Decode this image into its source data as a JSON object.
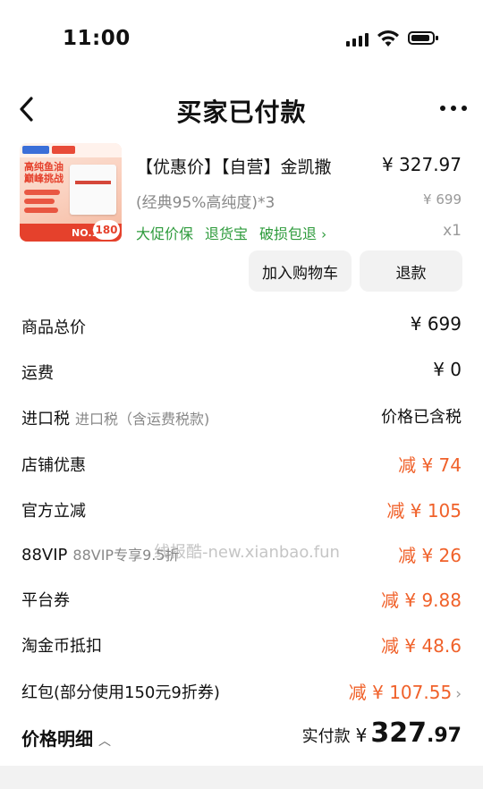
{
  "status_bar": {
    "time": "11:00"
  },
  "nav": {
    "title": "买家已付款"
  },
  "product": {
    "image": {
      "badge_number": "180",
      "rank_text": "NO.1",
      "headline_line1": "高纯鱼油",
      "headline_line2": "巅峰挑战"
    },
    "title": "【优惠价】【自营】金凯撒",
    "price": "¥ 327.97",
    "spec": "(经典95%高纯度)*3",
    "original_price": "¥ 699",
    "tags": [
      "大促价保",
      "退货宝",
      "破损包退"
    ],
    "qty": "x1",
    "add_to_cart_label": "加入购物车",
    "refund_label": "退款"
  },
  "rows": [
    {
      "label": "商品总价",
      "sub": "",
      "value": "¥ 699"
    },
    {
      "label": "运费",
      "sub": "",
      "value": "¥ 0"
    },
    {
      "label": "进口税",
      "sub": "进口税（含运费税款)",
      "value": "价格已含税"
    },
    {
      "label": "店铺优惠",
      "sub": "",
      "value": "减 ¥ 74"
    },
    {
      "label": "官方立减",
      "sub": "",
      "value": "减 ¥ 105"
    },
    {
      "label": "88VIP",
      "sub": "88VIP专享9.5折",
      "value": "减 ¥ 26"
    },
    {
      "label": "平台券",
      "sub": "",
      "value": "减 ¥ 9.88"
    },
    {
      "label": "淘金币抵扣",
      "sub": "",
      "value": "减 ¥ 48.6"
    },
    {
      "label": "红包(部分使用150元9折券)",
      "sub": "",
      "value": "减 ¥ 107.55"
    }
  ],
  "footer": {
    "label": "价格明细",
    "paid_label": "实付款",
    "currency": "¥",
    "amount_int": "327",
    "amount_dec": ".97"
  },
  "watermark": "线报酷-new.xianbao.fun",
  "colors": {
    "discount": "#f0612a",
    "tag_green": "#2e9b3c"
  }
}
